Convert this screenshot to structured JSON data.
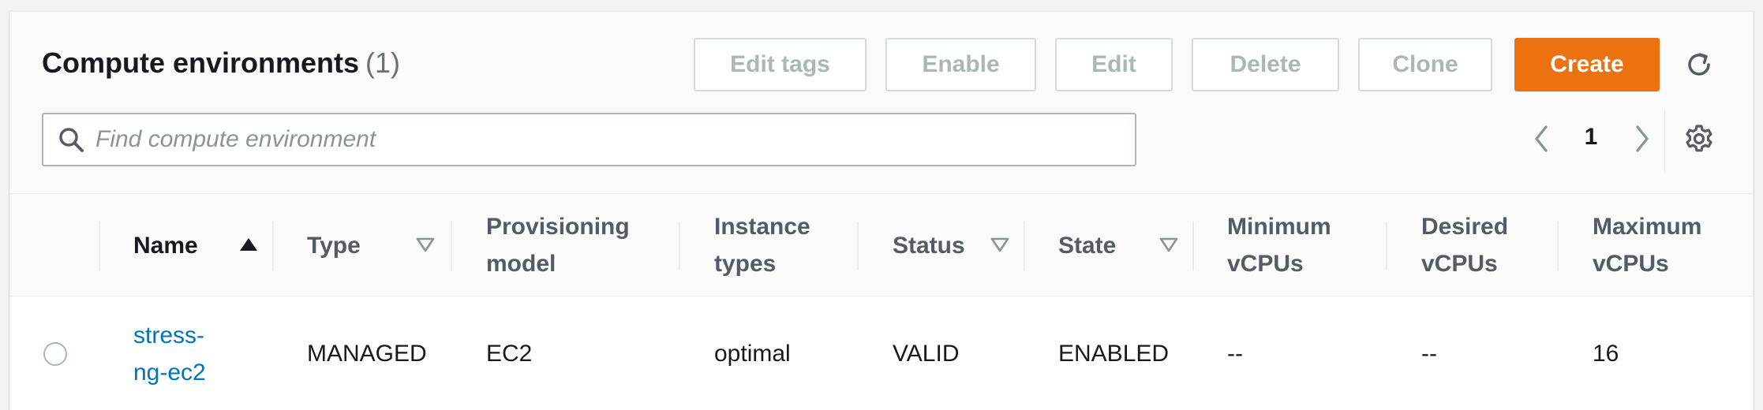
{
  "header": {
    "title": "Compute environments",
    "count": "(1)"
  },
  "toolbar": {
    "edit_tags_label": "Edit tags",
    "enable_label": "Enable",
    "edit_label": "Edit",
    "delete_label": "Delete",
    "clone_label": "Clone",
    "create_label": "Create",
    "refresh_icon": "refresh-icon"
  },
  "search": {
    "placeholder": "Find compute environment",
    "value": ""
  },
  "pagination": {
    "current_page": "1",
    "prev_icon": "chevron-left-icon",
    "next_icon": "chevron-right-icon",
    "settings_icon": "gear-icon"
  },
  "table": {
    "columns": [
      {
        "line1": "Name",
        "line2": "",
        "sort": "ascending"
      },
      {
        "line1": "Type",
        "line2": "",
        "sort": "sortable"
      },
      {
        "line1": "Provisioning",
        "line2": "model",
        "sort": ""
      },
      {
        "line1": "Instance",
        "line2": "types",
        "sort": ""
      },
      {
        "line1": "Status",
        "line2": "",
        "sort": "sortable"
      },
      {
        "line1": "State",
        "line2": "",
        "sort": "sortable"
      },
      {
        "line1": "Minimum",
        "line2": "vCPUs",
        "sort": ""
      },
      {
        "line1": "Desired",
        "line2": "vCPUs",
        "sort": ""
      },
      {
        "line1": "Maximum",
        "line2": "vCPUs",
        "sort": ""
      }
    ],
    "rows": [
      {
        "name_line1": "stress-",
        "name_line2": "ng-ec2",
        "type": "MANAGED",
        "provisioning_model": "EC2",
        "instance_types": "optimal",
        "status": "VALID",
        "state": "ENABLED",
        "min_vcpus": "--",
        "desired_vcpus": "--",
        "max_vcpus": "16"
      }
    ]
  },
  "colors": {
    "primary_button": "#ec7211",
    "link": "#0073bb",
    "disabled_text": "#aab7b8"
  }
}
